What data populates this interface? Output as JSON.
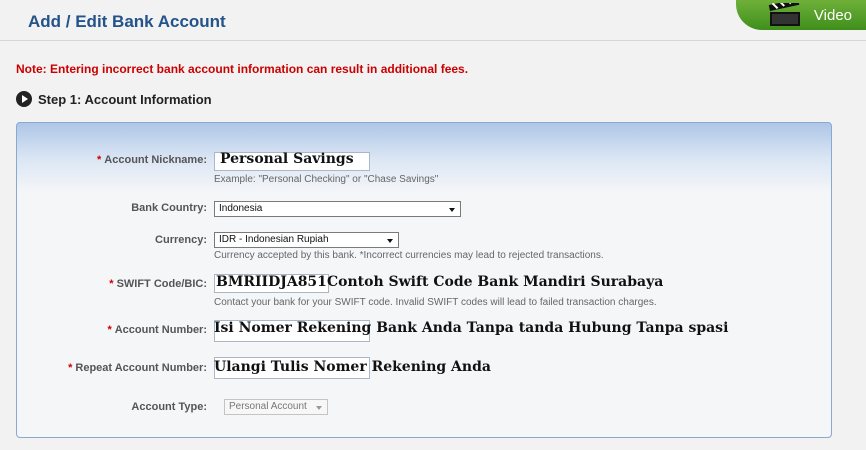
{
  "header": {
    "title": "Add / Edit Bank Account",
    "video_label": "Video"
  },
  "note": "Note: Entering incorrect bank account information can result in additional fees.",
  "step": {
    "label": "Step 1: Account Information"
  },
  "form": {
    "required_mark": "*",
    "nickname": {
      "label": "Account Nickname:",
      "value": "Personal Savings",
      "hint": "Example: \"Personal Checking\" or \"Chase Savings\""
    },
    "bank_country": {
      "label": "Bank Country:",
      "value": "Indonesia"
    },
    "currency": {
      "label": "Currency:",
      "value": "IDR - Indonesian Rupiah",
      "hint": "Currency accepted by this bank. *Incorrect currencies may lead to rejected transactions."
    },
    "swift": {
      "label": "SWIFT Code/BIC:",
      "value": "BMRIIDJA851",
      "annotation": "Contoh Swift Code Bank Mandiri Surabaya",
      "hint": "Contact your bank for your SWIFT code. Invalid SWIFT codes will lead to failed transaction charges."
    },
    "account_number": {
      "label": "Account Number:",
      "annotation": "Isi Nomer Rekening Bank Anda Tanpa tanda Hubung Tanpa spasi"
    },
    "repeat_account_number": {
      "label": "Repeat Account Number:",
      "annotation": "Ulangi Tulis Nomer Rekening Anda"
    },
    "account_type": {
      "label": "Account Type:",
      "value": "Personal Account"
    }
  },
  "colors": {
    "title": "#23538a",
    "note": "#cc0000",
    "video_tab": "#4f9e26",
    "panel_border": "#8aa9cf"
  },
  "icons": {
    "video": "clapperboard-icon",
    "step": "play-circle-icon"
  }
}
